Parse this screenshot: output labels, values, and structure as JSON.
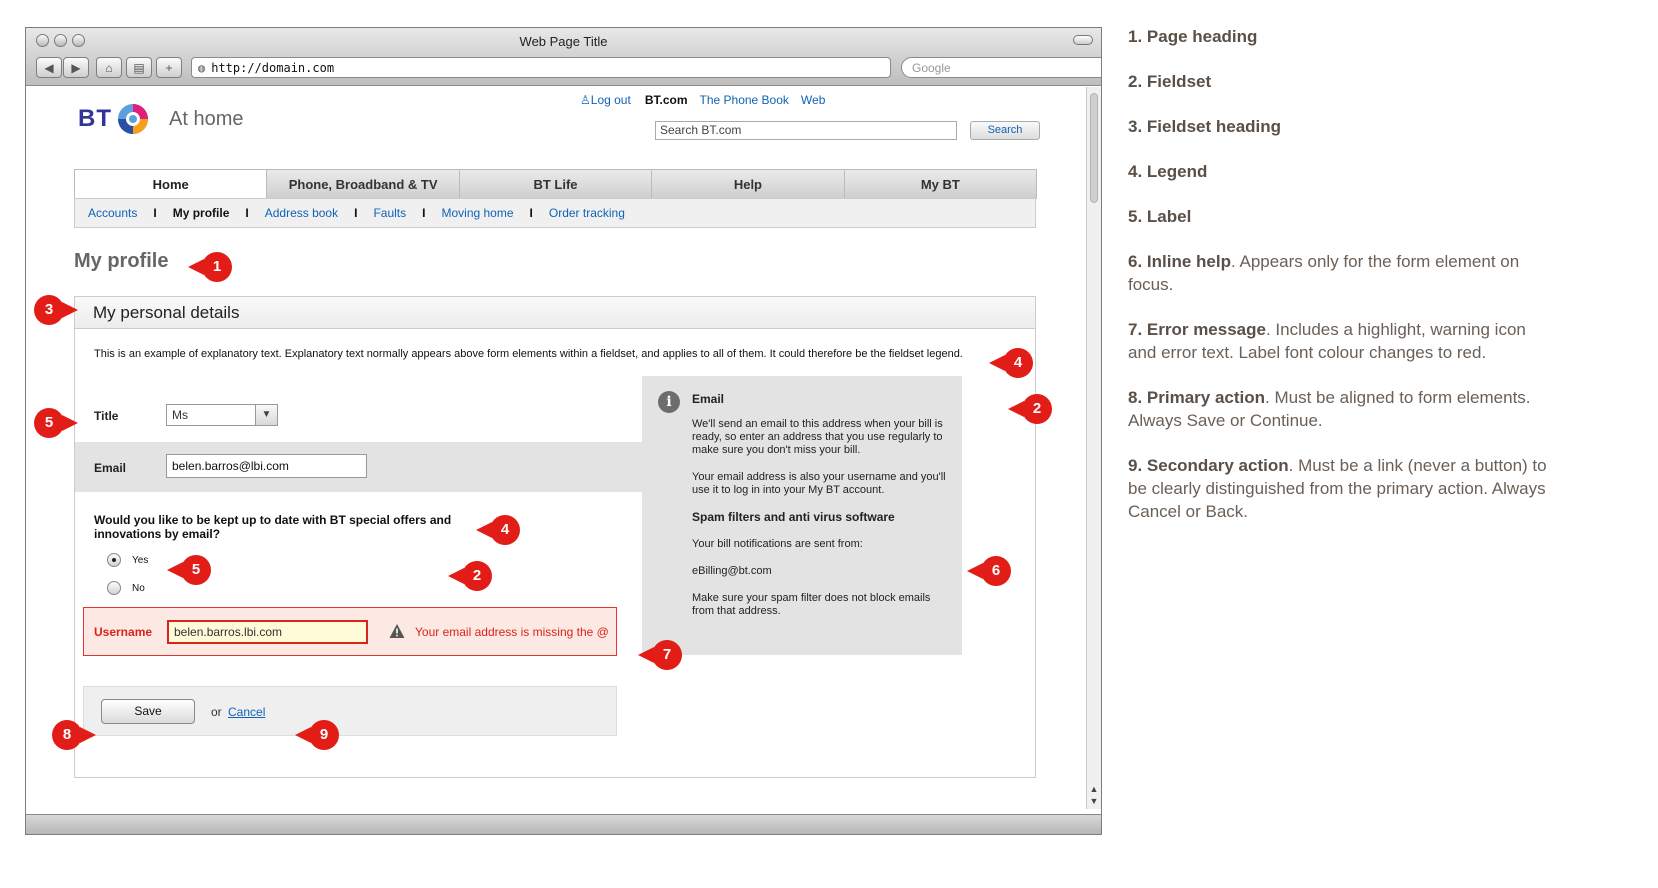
{
  "browser": {
    "window_title": "Web Page Title",
    "url": "http://domain.com",
    "search_placeholder": "Google"
  },
  "site": {
    "logo_text": "BT",
    "logo_subtitle": "At home",
    "logout": "Log out",
    "util_links": [
      "BT.com",
      "The Phone Book",
      "Web"
    ],
    "search_value": "Search BT.com",
    "search_button": "Search"
  },
  "nav": {
    "tabs": [
      "Home",
      "Phone, Broadband & TV",
      "BT Life",
      "Help",
      "My BT"
    ],
    "active_tab": "Home",
    "subnav": [
      "Accounts",
      "My profile",
      "Address book",
      "Faults",
      "Moving home",
      "Order tracking"
    ],
    "active_subnav": "My profile"
  },
  "page": {
    "title": "My profile",
    "fieldset_heading": "My personal details",
    "explanatory_text": "This is an example of explanatory text. Explanatory text normally appears above form elements within a fieldset, and applies to all of them. It could therefore be the fieldset legend."
  },
  "form": {
    "title_label": "Title",
    "title_value": "Ms",
    "email_label": "Email",
    "email_value": "belen.barros@lbi.com",
    "question": "Would you like to be kept up to date with BT special offers and innovations by email?",
    "radio_yes": "Yes",
    "radio_no": "No",
    "radio_selected": "Yes",
    "username_label": "Username",
    "username_value": "belen.barros.lbi.com",
    "error_text": "Your email address is missing the @",
    "save_button": "Save",
    "or_text": "or",
    "cancel_link": "Cancel"
  },
  "help": {
    "heading": "Email",
    "p1": "We'll send an email to this address when your bill is ready, so enter an address that you use regularly to make sure you don't miss your bill.",
    "p2": "Your email address is also your username and you'll use it to log in into your My BT account.",
    "heading2": "Spam filters and anti virus software",
    "p3": "Your bill notifications are sent from:",
    "p4": "eBilling@bt.com",
    "p5": "Make sure your spam filter does not block emails from that address."
  },
  "markers": {
    "page_heading": "1",
    "fieldset_right": "2",
    "fieldset_mid": "2",
    "fieldset_heading": "3",
    "legend_top": "4",
    "legend_question": "4",
    "label_title": "5",
    "label_radio": "5",
    "inline_help": "6",
    "error": "7",
    "primary": "8",
    "secondary": "9"
  },
  "notes": [
    {
      "title": "1. Page heading",
      "text": ""
    },
    {
      "title": "2. Fieldset",
      "text": ""
    },
    {
      "title": "3. Fieldset heading",
      "text": ""
    },
    {
      "title": "4. Legend",
      "text": ""
    },
    {
      "title": "5. Label",
      "text": ""
    },
    {
      "title": "6. Inline help",
      "text": ". Appears only for the form element on focus."
    },
    {
      "title": "7. Error message",
      "text": ". Includes a highlight, warning icon and error text. Label font colour changes to red."
    },
    {
      "title": "8. Primary action",
      "text": ". Must be aligned to form elements. Always Save or Continue."
    },
    {
      "title": "9. Secondary action",
      "text": ". Must be a link (never a button) to be clearly distinguished from the primary action. Always Cancel or Back."
    }
  ],
  "colors": {
    "marker": "#e21d18",
    "link": "#0f63b6",
    "error": "#d9241c",
    "bt_blue": "#333399"
  }
}
